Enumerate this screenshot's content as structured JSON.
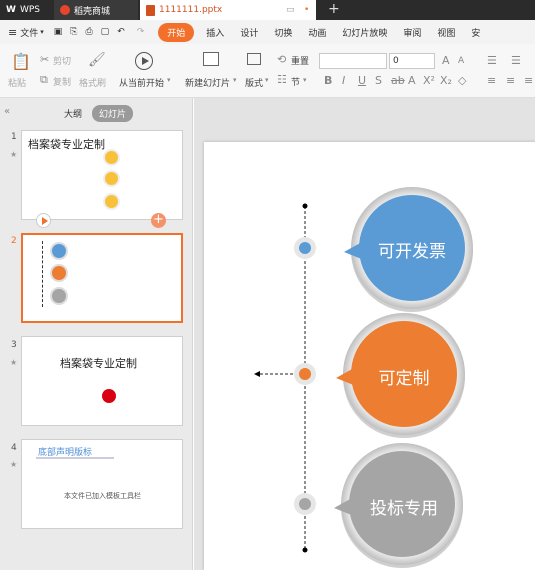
{
  "titlebar": {
    "wps_label": "WPS",
    "store_label": "稻壳商城",
    "doc_label": "1111111.pptx"
  },
  "menubar": {
    "file": "文件",
    "tabs": [
      "开始",
      "插入",
      "设计",
      "切换",
      "动画",
      "幻灯片放映",
      "审阅",
      "视图",
      "安"
    ]
  },
  "ribbon": {
    "paste": "粘贴",
    "cut": "剪切",
    "copy": "复制",
    "format_painter": "格式刷",
    "from_current": "从当前开始",
    "new_slide": "新建幻灯片",
    "layout": "版式",
    "reset": "重置",
    "section": "节",
    "font_size": "0"
  },
  "leftpane": {
    "tab_outline": "大纲",
    "tab_slides": "幻灯片",
    "slides": [
      {
        "num": "1",
        "title": "档案袋专业定制"
      },
      {
        "num": "2"
      },
      {
        "num": "3",
        "title": "档案袋专业定制"
      },
      {
        "num": "4",
        "title": "底部声明版标",
        "line": "本文件已加入模板工具栏"
      }
    ]
  },
  "slide": {
    "bubbles": [
      {
        "label": "可开发票",
        "color": "#5b9bd5"
      },
      {
        "label": "可定制",
        "color": "#ed7d31"
      },
      {
        "label": "投标专用",
        "color": "#a5a5a5"
      }
    ]
  },
  "colors": {
    "accent": "#f3702b",
    "blue": "#5b9bd5",
    "orange": "#ed7d31",
    "gray": "#a5a5a5"
  }
}
